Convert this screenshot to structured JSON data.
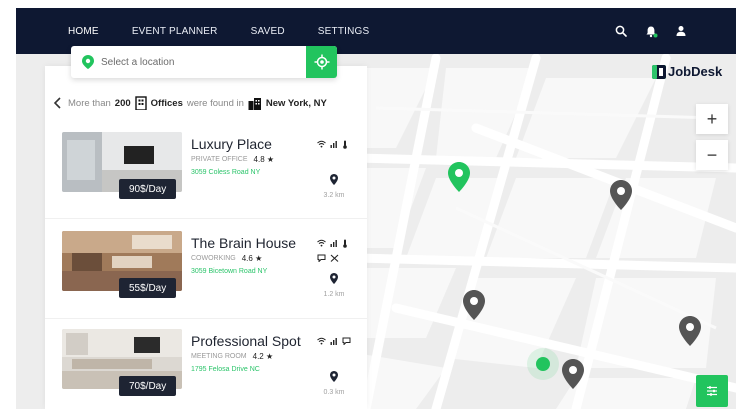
{
  "nav": {
    "items": [
      "HOME",
      "EVENT PLANNER",
      "SAVED",
      "SETTINGS"
    ],
    "active": "HOME",
    "icons": [
      "search-icon",
      "notification-icon",
      "user-icon"
    ]
  },
  "location": {
    "placeholder": "Select a location",
    "locate_icon": "locate-icon"
  },
  "results": {
    "prefix": "More than",
    "count": "200",
    "type": "Offices",
    "middle": "were found in",
    "city": "New York, NY"
  },
  "listings": [
    {
      "title": "Luxury Place",
      "type": "PRIVATE OFFICE",
      "rating": "4.8 ★",
      "address": "3059 Coless Road NY",
      "price": "90$/Day",
      "distance": "3.2 km",
      "amenities": [
        "wifi-icon",
        "signal-icon",
        "thermometer-icon"
      ]
    },
    {
      "title": "The Brain House",
      "type": "COWORKING",
      "rating": "4.6 ★",
      "address": "3059 Bicetown Road NY",
      "price": "55$/Day",
      "distance": "1.2 km",
      "amenities": [
        "wifi-icon",
        "signal-icon",
        "thermometer-icon",
        "chat-icon",
        "food-icon"
      ]
    },
    {
      "title": "Professional Spot",
      "type": "MEETING ROOM",
      "rating": "4.2 ★",
      "address": "1795 Felosa Drive NC",
      "price": "70$/Day",
      "distance": "0.3 km",
      "amenities": [
        "wifi-icon",
        "signal-icon",
        "chat-icon"
      ]
    }
  ],
  "brand": {
    "name": "JobDesk"
  },
  "map_controls": {
    "zoom_in": "+",
    "zoom_out": "−",
    "filter_icon": "filter-icon"
  },
  "colors": {
    "nav_bg": "#0e1832",
    "accent": "#22c45e",
    "pin_grey": "#555555"
  }
}
